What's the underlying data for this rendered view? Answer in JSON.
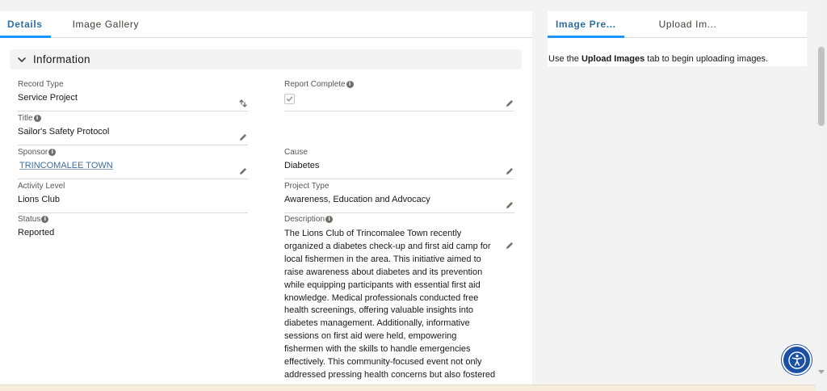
{
  "left_tabs": [
    {
      "label": "Details",
      "active": true
    },
    {
      "label": "Image Gallery",
      "active": false
    }
  ],
  "section": {
    "title": "Information"
  },
  "fields": {
    "record_type": {
      "label": "Record Type",
      "value": "Service Project"
    },
    "report_complete": {
      "label": "Report Complete",
      "checked": true
    },
    "title": {
      "label": "Title",
      "value": "Sailor's Safety Protocol"
    },
    "sponsor": {
      "label": "Sponsor",
      "value": "TRINCOMALEE TOWN"
    },
    "cause": {
      "label": "Cause",
      "value": "Diabetes"
    },
    "activity_level": {
      "label": "Activity Level",
      "value": "Lions Club"
    },
    "project_type": {
      "label": "Project Type",
      "value": "Awareness, Education and Advocacy"
    },
    "status": {
      "label": "Status",
      "value": "Reported"
    },
    "description": {
      "label": "Description",
      "value": "The Lions Club of Trincomalee Town recently organized a diabetes check-up and first aid camp for local fishermen in the area. This initiative aimed to raise awareness about diabetes and its prevention while equipping participants with essential first aid knowledge. Medical professionals conducted free health screenings, offering valuable insights into diabetes management. Additionally, informative sessions on first aid were held, empowering fishermen with the skills to handle emergencies effectively. This community-focused event not only addressed pressing health concerns but also fostered"
    }
  },
  "right_tabs": [
    {
      "label": "Image Pre...",
      "active": true
    },
    {
      "label": "Upload Im...",
      "active": false
    }
  ],
  "upload_hint": {
    "prefix": "Use the ",
    "bold": "Upload Images",
    "suffix": " tab to begin uploading images."
  },
  "colors": {
    "accent": "#1b96ff",
    "link": "#3d6ea1",
    "a11y_button": "#1a4fa5"
  },
  "icons": {
    "info": "i"
  }
}
